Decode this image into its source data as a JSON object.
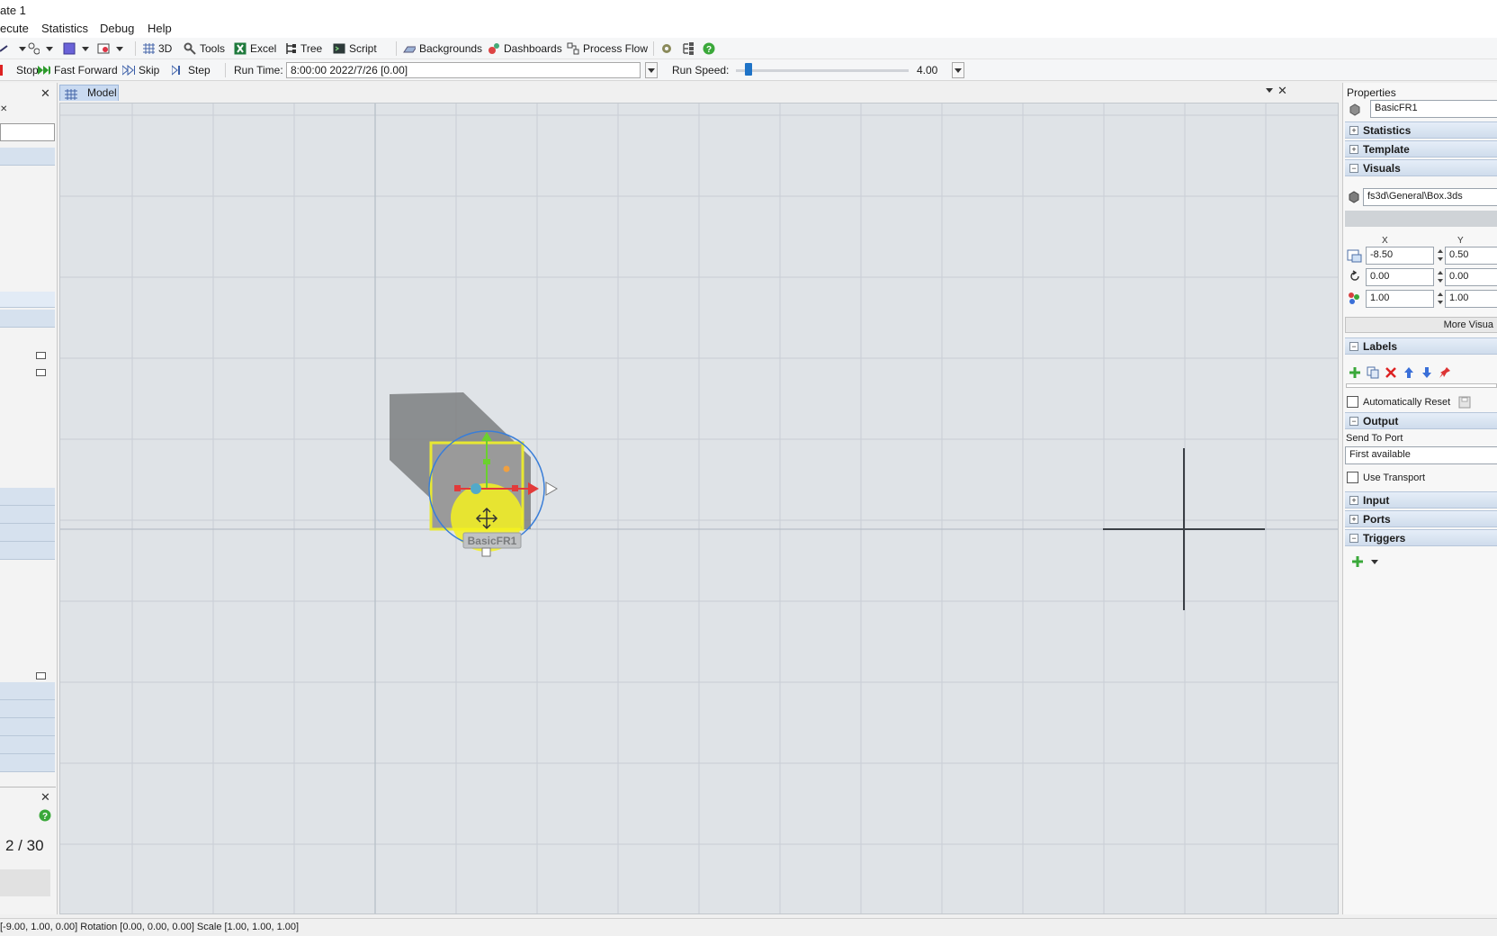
{
  "window": {
    "title": "ate 1"
  },
  "menu": {
    "items": [
      "ecute",
      "Statistics",
      "Debug",
      "Help"
    ]
  },
  "toolbar": {
    "btn_3d": "3D",
    "btn_tools": "Tools",
    "btn_excel": "Excel",
    "btn_tree": "Tree",
    "btn_script": "Script",
    "btn_backgrounds": "Backgrounds",
    "btn_dashboards": "Dashboards",
    "btn_process_flow": "Process Flow"
  },
  "runbar": {
    "stop": "Stop",
    "fast_forward": "Fast Forward",
    "skip": "Skip",
    "step": "Step",
    "run_time_label": "Run Time:",
    "run_time_value": "8:00:00  2022/7/26  [0.00]",
    "run_speed_label": "Run Speed:",
    "run_speed_value": "4.00"
  },
  "left_panel": {
    "counter": "2 / 30"
  },
  "model": {
    "tab_label": "Model",
    "object_label": "BasicFR1"
  },
  "properties": {
    "title": "Properties",
    "object_name": "BasicFR1",
    "sections": {
      "statistics": "Statistics",
      "template": "Template",
      "visuals": "Visuals",
      "labels": "Labels",
      "output": "Output",
      "input": "Input",
      "ports": "Ports",
      "triggers": "Triggers"
    },
    "visual_file": "fs3d\\General\\Box.3ds",
    "axis_x": "X",
    "axis_y": "Y",
    "position": {
      "x": "-8.50",
      "y": "0.50"
    },
    "rotation": {
      "x": "0.00",
      "y": "0.00"
    },
    "size": {
      "x": "1.00",
      "y": "1.00"
    },
    "more_visuals": "More Visua",
    "auto_reset": "Automatically Reset",
    "send_to_port_label": "Send To Port",
    "send_to_port_value": "First available",
    "use_transport": "Use Transport"
  },
  "status": {
    "text": "[-9.00, 1.00, 0.00]  Rotation [0.00, 0.00, 0.00]  Scale [1.00, 1.00, 1.00]"
  },
  "colors": {
    "accent": "#1e73c7",
    "selection": "#ffff33",
    "section_bg": "#d5e1ef"
  }
}
